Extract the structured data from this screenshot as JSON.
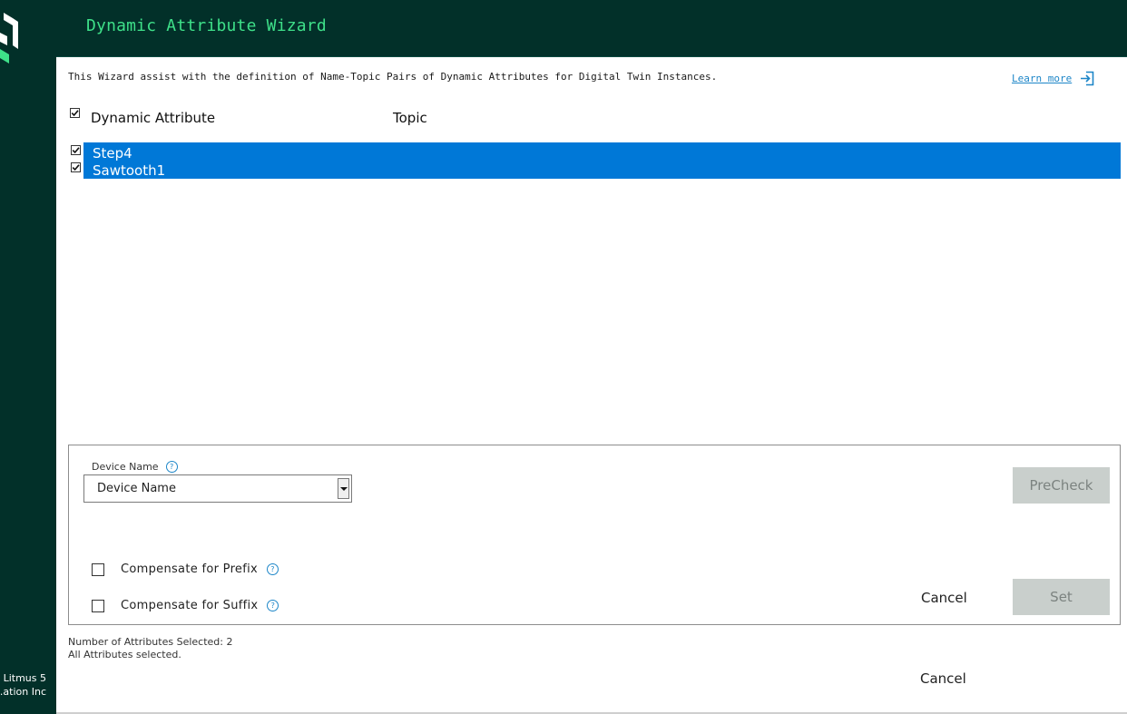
{
  "app": {
    "title": "Dynamic Attribute Wizard",
    "copyright_line1": "5 Litmus",
    "copyright_line2": "ation Inc.",
    "brand_color": "#023029",
    "accent_color": "#3ee089"
  },
  "intro": {
    "text": "This Wizard assist with the definition of Name-Topic Pairs of Dynamic Attributes for Digital Twin Instances.",
    "learn_more": "Learn more",
    "learn_more_icon": "external-link-icon"
  },
  "table": {
    "select_all_checked": true,
    "columns": [
      "Dynamic Attribute",
      "Topic"
    ],
    "rows": [
      {
        "name": "Step4",
        "topic": "",
        "checked": true
      },
      {
        "name": "Sawtooth1",
        "topic": "",
        "checked": true
      }
    ],
    "selection_color": "#0078d7"
  },
  "panel": {
    "device_label": "Device Name",
    "device_help_icon": "help-icon",
    "device_value": "Device Name",
    "precheck_label": "PreCheck",
    "compensate_prefix_label": "Compensate for Prefix",
    "compensate_prefix_checked": false,
    "compensate_suffix_label": "Compensate for Suffix",
    "compensate_suffix_checked": false,
    "cancel_label": "Cancel",
    "set_label": "Set"
  },
  "status": {
    "count_text": "Number of Attributes Selected: 2",
    "all_text": "All Attributes selected."
  },
  "footer": {
    "cancel_label": "Cancel"
  }
}
